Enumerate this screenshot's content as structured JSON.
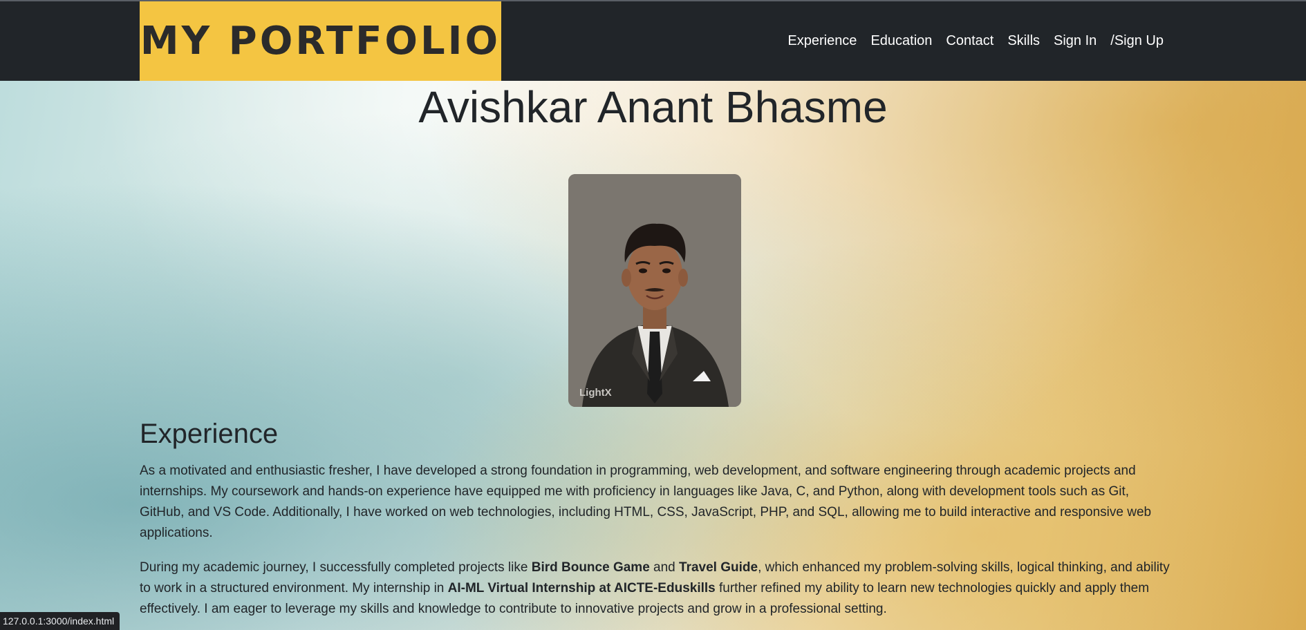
{
  "navbar": {
    "brand": "MY PORTFOLIO",
    "links": [
      {
        "label": "Experience"
      },
      {
        "label": "Education"
      },
      {
        "label": "Contact"
      },
      {
        "label": "Skills"
      },
      {
        "label": "Sign In"
      },
      {
        "label": "/Sign Up"
      }
    ]
  },
  "profile": {
    "name": "Avishkar Anant Bhasme",
    "photo_watermark": "LightX"
  },
  "experience": {
    "heading": "Experience",
    "paragraph1": "As a motivated and enthusiastic fresher, I have developed a strong foundation in programming, web development, and software engineering through academic projects and internships. My coursework and hands-on experience have equipped me with proficiency in languages like Java, C, and Python, along with development tools such as Git, GitHub, and VS Code. Additionally, I have worked on web technologies, including HTML, CSS, JavaScript, PHP, and SQL, allowing me to build interactive and responsive web applications.",
    "paragraph2": {
      "part1": "During my academic journey, I successfully completed projects like ",
      "project1": "Bird Bounce Game",
      "part2": " and ",
      "project2": "Travel Guide",
      "part3": ", which enhanced my problem-solving skills, logical thinking, and ability to work in a structured environment. My internship in ",
      "internship": "AI-ML Virtual Internship at AICTE-Eduskills",
      "part4": " further refined my ability to learn new technologies quickly and apply them effectively. I am eager to leverage my skills and knowledge to contribute to innovative projects and grow in a professional setting."
    }
  },
  "status_bar": {
    "url": "127.0.0.1:3000/index.html"
  },
  "colors": {
    "navbar_bg": "#212529",
    "brand_bg": "#f4c542",
    "text": "#212529"
  }
}
